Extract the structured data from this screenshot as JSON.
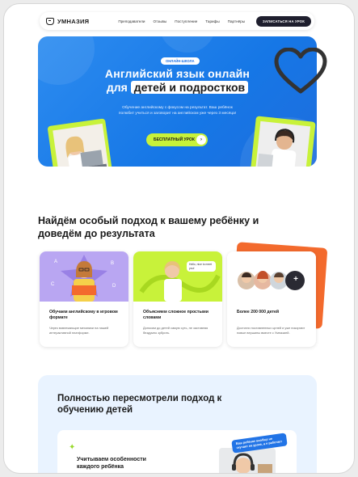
{
  "nav": {
    "logo": "УМНАЗИЯ",
    "links": [
      "Преподаватели",
      "Отзывы",
      "Поступление",
      "Тарифы",
      "Партнёры"
    ],
    "cta": "ЗАПИСАТЬСЯ НА УРОК"
  },
  "hero": {
    "badge": "ОНЛАЙН-ШКОЛА",
    "title_line1": "Английский язык онлайн",
    "title_pre": "для",
    "title_highlight": "детей и подростков",
    "subtitle": "Обучение английскому с фокусом на результат. Ваш ребёнок полюбит учиться и заговорит на английском уже через 3 месяца!",
    "button": "БЕСПЛАТНЫЙ УРОК",
    "button_arrow": "›"
  },
  "section_approach": {
    "title": "Найдём особый подход к вашему ребёнку и доведём до результата",
    "cards": [
      {
        "title": "Обучаем английскому в игровом формате",
        "desc": "Через вовлекающие механики на нашей интерактивной платформе."
      },
      {
        "title": "Объясняем сложное простыми словами",
        "desc": "Доносим до детей самую суть, не заставляя бездумно зубрить.",
        "bubble": "Hello, nice to meet you!"
      },
      {
        "title": "Более 200 000 детей",
        "desc": "Достигли поставленных целей и уже покоряют новые вершины вместе с Умназией.",
        "plus": "+"
      }
    ]
  },
  "section_reviewed": {
    "title": "Полностью пересмотрели подход к обучению детей",
    "card_title": "Учитываем особенности каждого ребёнка",
    "spark": "✦",
    "tag": "Ваш ребёнок вообще не скучает на уроке, а я работает"
  },
  "colors": {
    "hero_blue": "#1677e6",
    "lime": "#c8f23a",
    "dark": "#1f1f2e",
    "purple": "#b9a6f2",
    "orange": "#f36a2d"
  }
}
